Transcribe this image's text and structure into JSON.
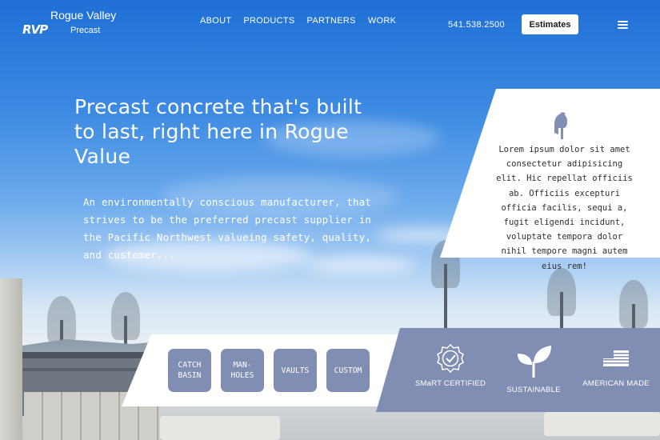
{
  "header": {
    "logo_text": "RVP",
    "brand_name": "Rogue Valley",
    "brand_sub": "Precast",
    "nav": [
      "ABOUT",
      "PRODUCTS",
      "PARTNERS",
      "WORK"
    ],
    "phone": "541.538.2500",
    "cta_label": "Estimates",
    "menu_icon": "hamburger-icon"
  },
  "hero": {
    "headline": "Precast concrete that's built to last, right here in Rogue Value",
    "intro": "An environmentally conscious manufacturer, that strives to be the preferred precast supplier in the Pacific Northwest valueing safety, quality, and customer..."
  },
  "card": {
    "icon": "helmet-icon",
    "text": "Lorem ipsum dolor sit amet consectetur adipisicing elit. Hic repellat officiis ab. Officiis excepturi officia facilis, sequi a, fugit eligendi incidunt, voluptate tempora dolor nihil tempore magni autem eius rem!"
  },
  "products": [
    {
      "line1": "CATCH",
      "line2": "BASIN"
    },
    {
      "line1": "MAN-",
      "line2": "HOLES"
    },
    {
      "line1": "VAULTS",
      "line2": ""
    },
    {
      "line1": "CUSTOM",
      "line2": ""
    }
  ],
  "features": [
    {
      "label": "SMaRT CERTIFIED",
      "icon": "certified-badge-icon"
    },
    {
      "label": "SUSTAINABLE",
      "icon": "leaf-sprout-icon"
    },
    {
      "label": "AMERICAN MADE",
      "icon": "us-flag-icon"
    }
  ],
  "colors": {
    "accent_blue": "#7f8eb2",
    "sky_top": "#1f6fd6",
    "white": "#ffffff",
    "card_text": "#2b2f34"
  }
}
